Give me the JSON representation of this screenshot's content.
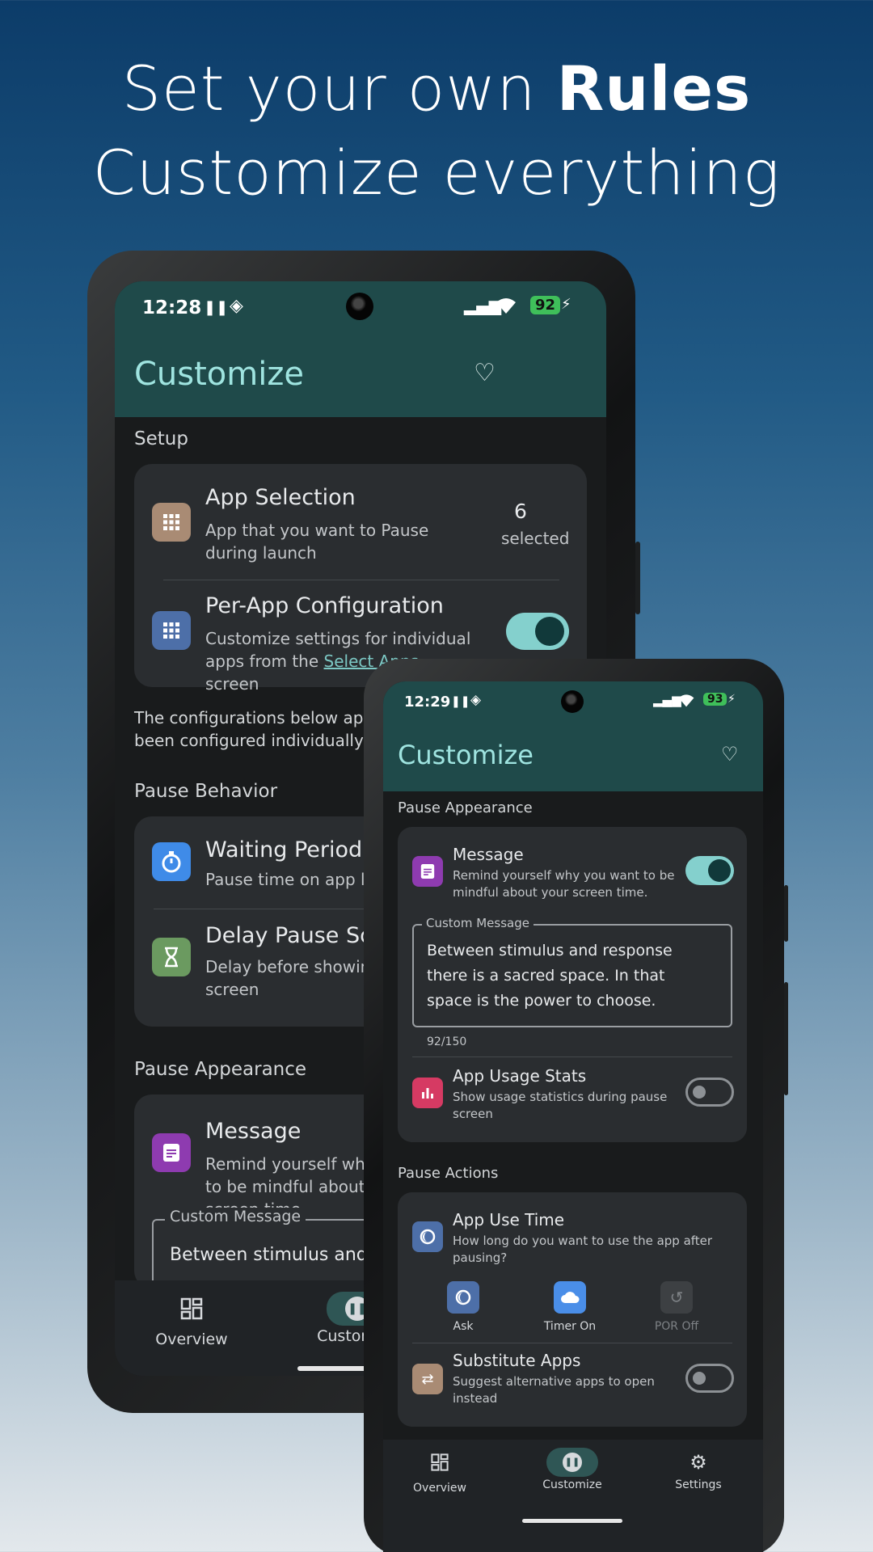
{
  "headline": {
    "line1_pre": "Set your own ",
    "line1_bold": "Rules",
    "line2": "Customize everything"
  },
  "colors": {
    "accent": "#84d0cd",
    "topbar": "#1f4a4a",
    "title": "#9fe4e0"
  },
  "phone_back": {
    "status": {
      "time": "12:28",
      "battery": "92"
    },
    "title": "Customize",
    "setup": {
      "header": "Setup",
      "app_selection": {
        "title": "App Selection",
        "subtitle": "App that you want to Pause during launch",
        "count": "6",
        "count_label": "selected",
        "icon": "grid-icon"
      },
      "per_app": {
        "title": "Per-App Configuration",
        "subtitle_pre": "Customize settings for individual apps from the ",
        "subtitle_link": "Select Apps",
        "subtitle_post": " screen",
        "toggle": true,
        "icon": "grid-icon"
      }
    },
    "note": "The configurations below apply to apps that have not been configured individually",
    "pause_behavior": {
      "header": "Pause Behavior",
      "waiting": {
        "title": "Waiting Period",
        "subtitle": "Pause time on app launch",
        "icon": "stopwatch-icon"
      },
      "delay": {
        "title": "Delay Pause Screen",
        "subtitle": "Delay before showing pause screen",
        "icon": "hourglass-icon"
      }
    },
    "pause_appearance": {
      "header": "Pause Appearance",
      "message": {
        "title": "Message",
        "subtitle": "Remind yourself why you want to be mindful about your screen time.",
        "icon": "document-icon"
      },
      "custom_label": "Custom Message",
      "custom_value": "Between stimulus and response"
    },
    "nav": {
      "overview": "Overview",
      "customize": "Customize"
    }
  },
  "phone_front": {
    "status": {
      "time": "12:29",
      "battery": "93"
    },
    "title": "Customize",
    "pause_appearance": {
      "header": "Pause Appearance",
      "message": {
        "title": "Message",
        "subtitle": "Remind yourself why you want to be mindful about your screen time.",
        "toggle": true,
        "icon": "document-icon"
      },
      "custom_label": "Custom Message",
      "custom_value": "Between stimulus and response there is a sacred space. In that space is the power to choose.",
      "counter": "92/150",
      "usage": {
        "title": "App Usage Stats",
        "subtitle": "Show usage statistics during pause screen",
        "toggle": false,
        "icon": "bar-chart-icon"
      }
    },
    "pause_actions": {
      "header": "Pause Actions",
      "use_time": {
        "title": "App Use Time",
        "subtitle": "How long do you want to use the app after pausing?",
        "icon": "moon-icon"
      },
      "options": [
        {
          "label": "Ask",
          "icon": "moon-icon",
          "state": "selected"
        },
        {
          "label": "Timer On",
          "icon": "cloud-icon",
          "state": "selected"
        },
        {
          "label": "POR Off",
          "icon": "undo-icon",
          "state": "disabled"
        }
      ],
      "substitute": {
        "title": "Substitute Apps",
        "subtitle": "Suggest alternative apps to open instead",
        "toggle": false,
        "icon": "swap-icon"
      }
    },
    "nav": {
      "overview": "Overview",
      "customize": "Customize",
      "settings": "Settings"
    }
  }
}
